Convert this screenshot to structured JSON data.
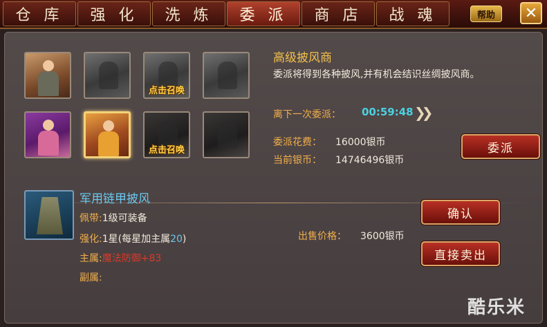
{
  "tabs": [
    "仓 库",
    "强 化",
    "洗 炼",
    "委 派",
    "商 店",
    "战 魂"
  ],
  "active_tab_index": 3,
  "help_label": "帮助",
  "close_label": "✕",
  "slots": [
    {
      "type": "character",
      "summon_label": ""
    },
    {
      "type": "locked",
      "summon_label": ""
    },
    {
      "type": "locked",
      "summon_label": "点击召唤"
    },
    {
      "type": "locked",
      "summon_label": ""
    },
    {
      "type": "character",
      "summon_label": ""
    },
    {
      "type": "character",
      "summon_label": ""
    },
    {
      "type": "locked",
      "summon_label": "点击召唤"
    },
    {
      "type": "locked",
      "summon_label": ""
    }
  ],
  "mission": {
    "title": "高级披风商",
    "description": "委派将得到各种披风,并有机会结识丝绸披风商。",
    "countdown_label": "离下一次委派：",
    "countdown_value": "00:59:48",
    "cost_label": "委派花费：",
    "cost_value": "16000银币",
    "silver_label": "当前银币：",
    "silver_value": "14746496银币",
    "button_label": "委派"
  },
  "item": {
    "name": "军用链甲披风",
    "wear_label": "佩带:",
    "wear_value": "1级可装备",
    "enhance_label": "强化:",
    "enhance_value_prefix": "1星(每星加主属",
    "enhance_value_num": "20",
    "enhance_value_suffix": ")",
    "main_label": "主属:",
    "main_value": "魔法防御+83",
    "sub_label": "副属:",
    "price_label": "出售价格：",
    "price_value": "3600银币",
    "confirm_label": "确认",
    "sell_label": "直接卖出"
  },
  "watermark": "酷乐米",
  "colors": {
    "accent_gold": "#f2b04a",
    "title_gold": "#f2c14a",
    "item_blue": "#6ac8f0",
    "countdown_cyan": "#4ad2e0",
    "main_attr_red": "#d83a2a"
  }
}
